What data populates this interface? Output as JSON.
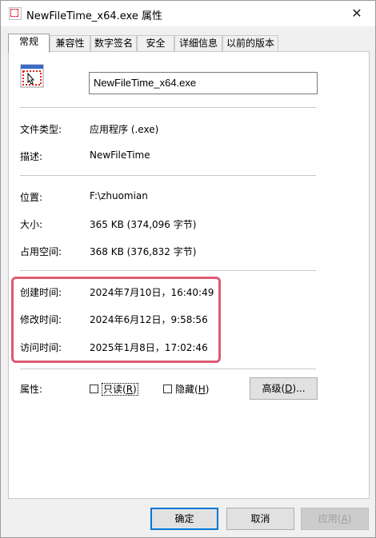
{
  "window": {
    "title": "NewFileTime_x64.exe 属性",
    "close_glyph": "✕"
  },
  "tabs": [
    {
      "label": "常规",
      "active": true
    },
    {
      "label": "兼容性"
    },
    {
      "label": "数字签名"
    },
    {
      "label": "安全"
    },
    {
      "label": "详细信息"
    },
    {
      "label": "以前的版本"
    }
  ],
  "file": {
    "name": "NewFileTime_x64.exe",
    "icon": "application-icon"
  },
  "info": {
    "type_label": "文件类型:",
    "type_value": "应用程序 (.exe)",
    "desc_label": "描述:",
    "desc_value": "NewFileTime",
    "location_label": "位置:",
    "location_value": "F:\\zhuomian",
    "size_label": "大小:",
    "size_value": "365 KB (374,096 字节)",
    "disk_label": "占用空间:",
    "disk_value": "368 KB (376,832 字节)"
  },
  "times": {
    "created_label": "创建时间:",
    "created_value": "2024年7月10日，16:40:49",
    "modified_label": "修改时间:",
    "modified_value": "2024年6月12日，9:58:56",
    "accessed_label": "访问时间:",
    "accessed_value": "2025年1月8日，17:02:46",
    "highlight_color": "#e05a73"
  },
  "attributes": {
    "label": "属性:",
    "readonly_text": "只读",
    "readonly_key": "R",
    "readonly_checked": false,
    "hidden_text": "隐藏",
    "hidden_key": "H",
    "hidden_checked": false,
    "advanced_text": "高级",
    "advanced_key": "D",
    "advanced_suffix": "..."
  },
  "buttons": {
    "ok": "确定",
    "cancel": "取消",
    "apply_text": "应用",
    "apply_key": "A"
  }
}
